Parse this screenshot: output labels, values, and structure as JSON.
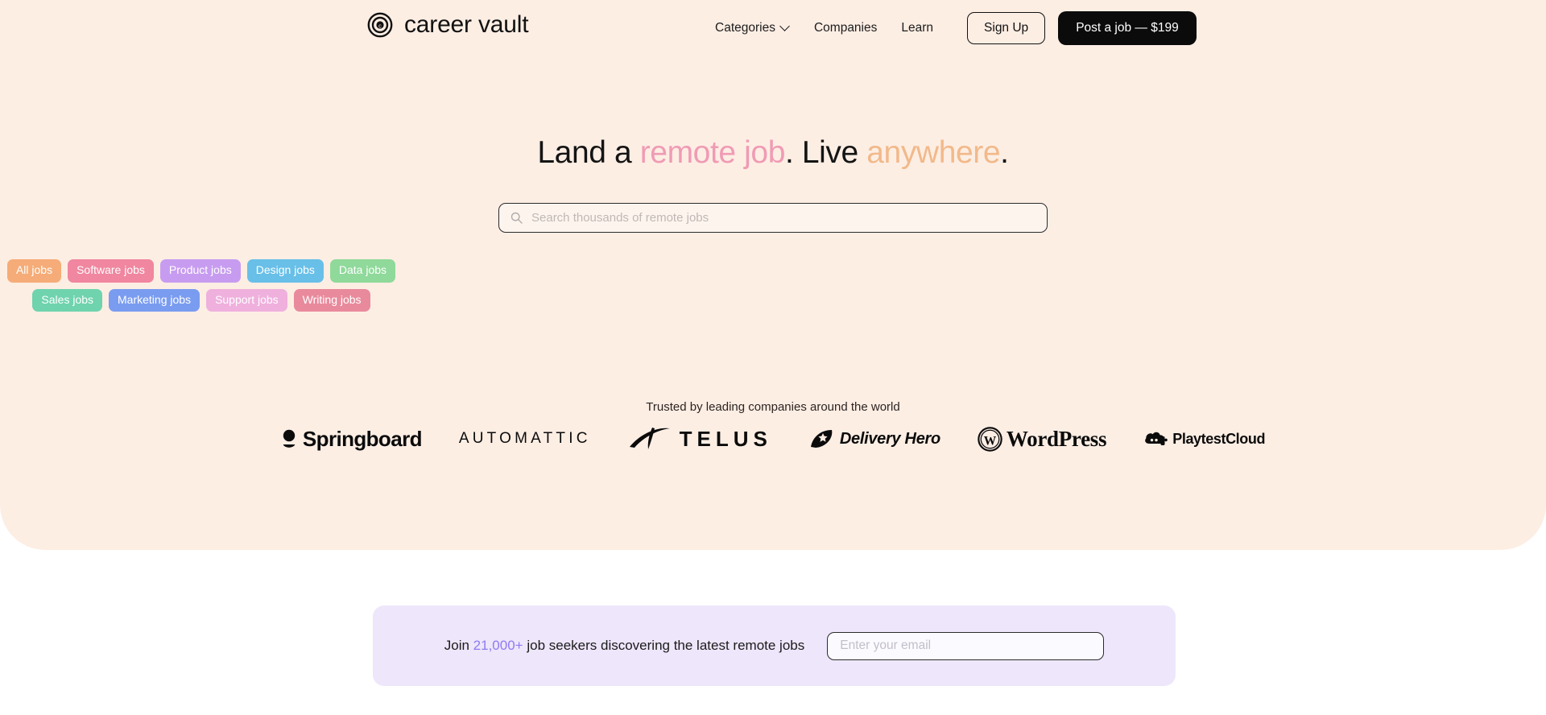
{
  "brand": {
    "name": "career vault",
    "logo_icon": "bullseye-target-icon"
  },
  "nav": {
    "categories": "Categories",
    "categories_icon": "chevron-down-icon",
    "companies": "Companies",
    "learn": "Learn",
    "sign_up": "Sign Up",
    "post_job": "Post a job — $199"
  },
  "hero": {
    "headline_part1": "Land a ",
    "headline_accent1": "remote job",
    "headline_part2": ". Live ",
    "headline_accent2": "anywhere",
    "headline_part3": ".",
    "accent1_color": "#f09bb4",
    "accent2_color": "#f2b98a",
    "background_color": "#fdeee4"
  },
  "search": {
    "placeholder": "Search thousands of remote jobs",
    "value": "",
    "icon": "search-icon"
  },
  "pills": [
    {
      "label": "All jobs",
      "color": "#f5ac78"
    },
    {
      "label": "Software jobs",
      "color": "#f0869f"
    },
    {
      "label": "Product jobs",
      "color": "#c79cf0"
    },
    {
      "label": "Design jobs",
      "color": "#68bfe8"
    },
    {
      "label": "Data jobs",
      "color": "#8fd99a"
    },
    {
      "label": "Sales jobs",
      "color": "#6fd3ae"
    },
    {
      "label": "Marketing jobs",
      "color": "#7a9cf0"
    },
    {
      "label": "Support jobs",
      "color": "#efb0dd"
    },
    {
      "label": "Writing jobs",
      "color": "#e98a9c"
    }
  ],
  "trusted": {
    "caption": "Trusted by leading companies around the world",
    "logos": [
      {
        "name": "Springboard",
        "icon": "springboard-icon"
      },
      {
        "name": "AUTOMATTIC",
        "icon": "automattic-icon"
      },
      {
        "name": "TELUS",
        "icon": "telus-swoosh-icon"
      },
      {
        "name": "Delivery Hero",
        "icon": "delivery-hero-icon"
      },
      {
        "name": "WordPress",
        "icon": "wordpress-icon"
      },
      {
        "name": "PlaytestCloud",
        "icon": "playtestcloud-cloud-icon"
      }
    ]
  },
  "newsletter": {
    "text_before": "Join ",
    "count": "21,000+",
    "text_after": " job seekers discovering the latest remote jobs",
    "count_color": "#8e7cf0",
    "email_placeholder": "Enter your email",
    "email_value": "",
    "background_color": "#eee6fb"
  }
}
